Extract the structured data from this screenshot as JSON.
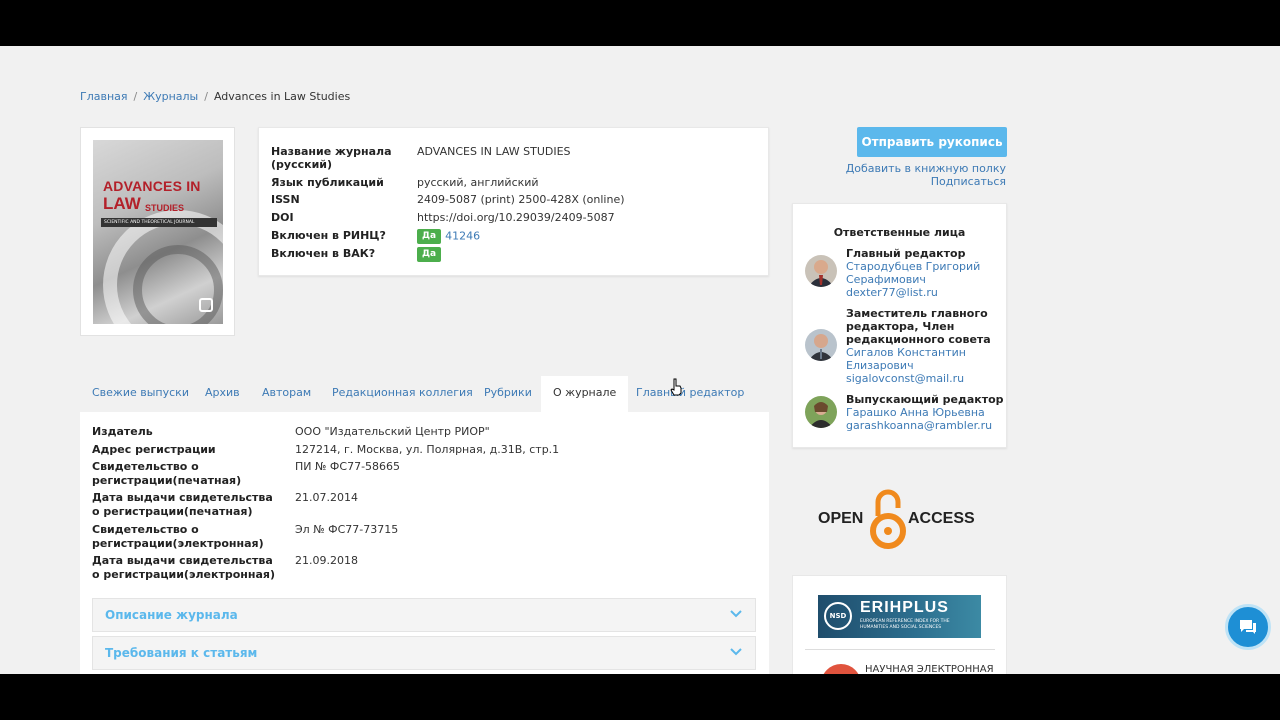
{
  "breadcrumb": {
    "home": "Главная",
    "journals": "Журналы",
    "current": "Advances in Law Studies"
  },
  "cover": {
    "title1": "ADVANCES IN",
    "title2": "LAW",
    "title3": "STUDIES",
    "subtitle": "SCIENTIFIC AND THEORETICAL JOURNAL"
  },
  "journal_info": {
    "name_label": "Название журнала (русский)",
    "name_value": "ADVANCES IN LAW STUDIES",
    "lang_label": "Язык публикаций",
    "lang_value": "русский, английский",
    "issn_label": "ISSN",
    "issn_value": "2409-5087 (print) 2500-428X (online)",
    "doi_label": "DOI",
    "doi_value": "https://doi.org/10.29039/2409-5087",
    "rinc_label": "Включен в РИНЦ?",
    "rinc_badge": "Да",
    "rinc_id": "41246",
    "vak_label": "Включен в ВАК?",
    "vak_badge": "Да"
  },
  "sidebar": {
    "submit_button": "Отправить рукопись",
    "add_shelf": "Добавить в книжную полку",
    "subscribe": "Подписаться",
    "persons_title": "Ответственные лица",
    "persons": [
      {
        "role": "Главный редактор",
        "name": "Стародубцев Григорий Серафимович",
        "email": "dexter77@list.ru"
      },
      {
        "role": "Заместитель главного редактора, Член редакционного совета",
        "name": "Сигалов Константин Елизарович",
        "email": "sigalovconst@mail.ru"
      },
      {
        "role": "Выпускающий редактор",
        "name": "Гарашко Анна Юрьевна",
        "email": "garashkoanna@rambler.ru"
      }
    ],
    "open_access_left": "OPEN",
    "open_access_right": "ACCESS",
    "erih_short": "NSD",
    "erih_title": "ERIHPLUS",
    "erih_sub": "EUROPEAN REFERENCE INDEX FOR THE HUMANITIES AND SOCIAL SCIENCES",
    "elib_text": "НАУЧНАЯ ЭЛЕКТРОННАЯ"
  },
  "tabs": [
    "Свежие выпуски",
    "Архив",
    "Авторам",
    "Редакционная коллегия",
    "Рубрики",
    "О журнале",
    "Главный редактор"
  ],
  "active_tab": "О журнале",
  "about": {
    "rows": [
      {
        "k": "Издатель",
        "v": "ООО \"Издательский Центр РИОР\""
      },
      {
        "k": "Адрес регистрации",
        "v": "127214, г. Москва, ул. Полярная, д.31В, стр.1"
      },
      {
        "k": "Свидетельство о регистрации(печатная)",
        "v": "ПИ № ФС77-58665"
      },
      {
        "k": "Дата выдачи свидетельства о регистрации(печатная)",
        "v": "21.07.2014"
      },
      {
        "k": "Свидетельство о регистрации(электронная)",
        "v": "Эл № ФС77-73715"
      },
      {
        "k": "Дата выдачи свидетельства о регистрации(электронная)",
        "v": "21.09.2018"
      }
    ],
    "accordion1": "Описание журнала",
    "accordion2": "Требования к статьям"
  },
  "colors": {
    "accent": "#5bb8ec",
    "link": "#3d7ab5",
    "badge": "#4cae4c"
  }
}
